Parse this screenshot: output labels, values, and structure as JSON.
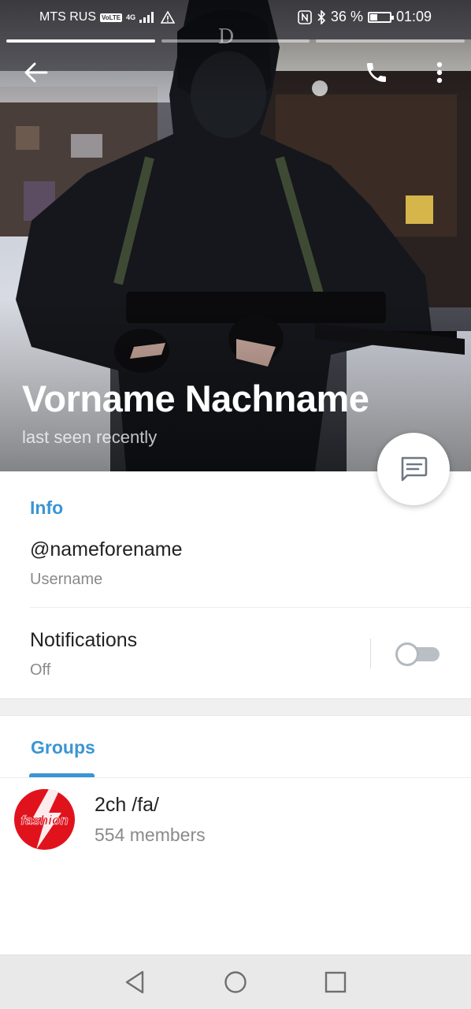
{
  "status_bar": {
    "carrier": "MTS RUS",
    "volte": "VoLTE",
    "network": "4G",
    "battery": "36 %",
    "battery_level": 0.36,
    "time": "01:09"
  },
  "story_progress": {
    "segments": 3,
    "active_index": 0
  },
  "profile": {
    "name": "Vorname Nachname",
    "status": "last seen recently"
  },
  "icons": {
    "back": "arrow-left-icon",
    "call": "phone-icon",
    "more": "more-vertical-icon",
    "message": "message-icon",
    "nav_back": "nav-back-icon",
    "nav_home": "nav-home-icon",
    "nav_recents": "nav-recents-icon"
  },
  "info": {
    "title": "Info",
    "username": "@nameforename",
    "username_label": "Username",
    "notifications_label": "Notifications",
    "notifications_value": "Off",
    "notifications_enabled": false
  },
  "groups": {
    "tab_label": "Groups",
    "items": [
      {
        "name": "2ch /fa/",
        "members": "554 members",
        "avatar_text": "fashion"
      }
    ]
  },
  "colors": {
    "accent": "#3a95d5",
    "avatar_red": "#e0131d"
  }
}
